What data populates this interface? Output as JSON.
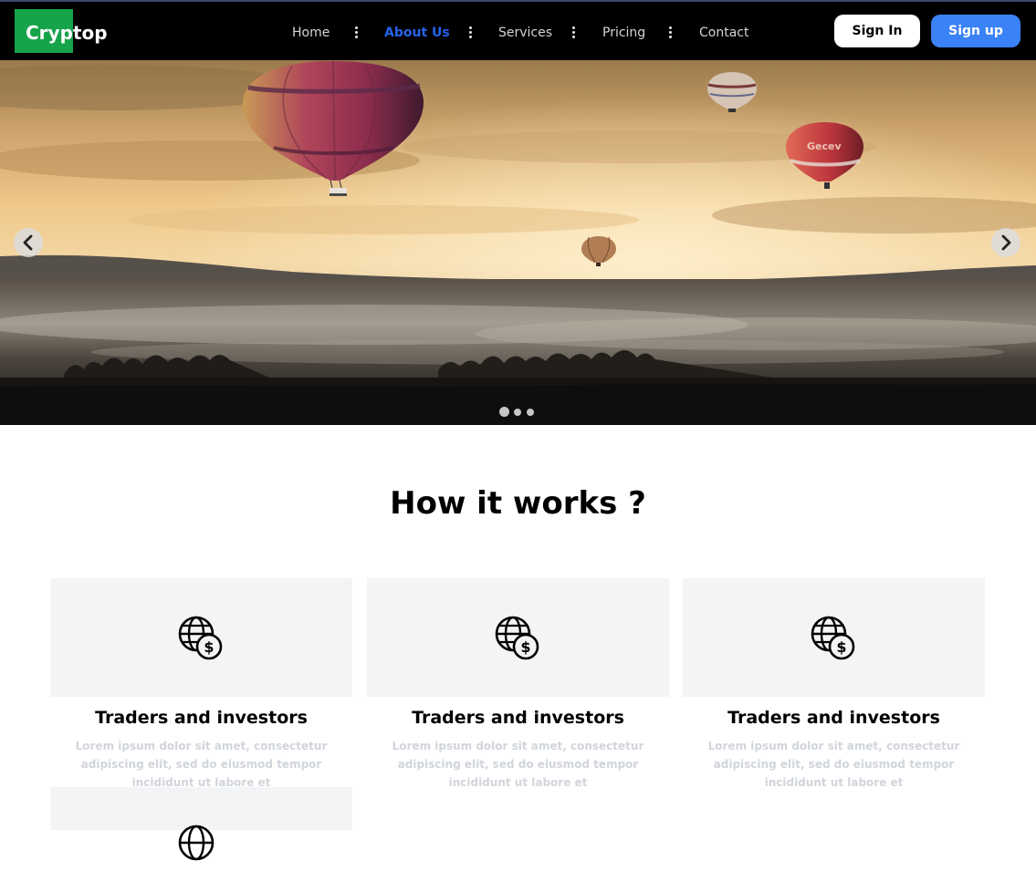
{
  "brand": {
    "name": "Cryptop",
    "logo_color": "#16a34a"
  },
  "nav": {
    "items": [
      {
        "label": "Home",
        "active": false
      },
      {
        "label": "About Us",
        "active": true
      },
      {
        "label": "Services",
        "active": false
      },
      {
        "label": "Pricing",
        "active": false
      },
      {
        "label": "Contact",
        "active": false
      }
    ],
    "separator_icon": "vertical-dots-icon",
    "active_color": "#2563eb"
  },
  "auth": {
    "signin_label": "Sign In",
    "signup_label": "Sign up",
    "signup_color": "#3b82f6"
  },
  "carousel": {
    "image_subject": "hot air balloons over misty valley at sunset",
    "prev_icon": "chevron-left-icon",
    "next_icon": "chevron-right-icon",
    "slide_count": 3,
    "active_slide": 1
  },
  "how_it_works": {
    "title": "How it works ?",
    "cards": [
      {
        "icon": "globe-dollar-icon",
        "title": "Traders and investors",
        "text": "Lorem ipsum dolor sit amet, consectetur adipiscing elit, sed do eiusmod tempor incididunt ut labore et"
      },
      {
        "icon": "globe-dollar-icon",
        "title": "Traders and investors",
        "text": "Lorem ipsum dolor sit amet, consectetur adipiscing elit, sed do eiusmod tempor incididunt ut labore et"
      },
      {
        "icon": "globe-dollar-icon",
        "title": "Traders and investors",
        "text": "Lorem ipsum dolor sit amet, consectetur adipiscing elit, sed do eiusmod tempor incididunt ut labore et"
      },
      {
        "icon": "globe-dollar-icon"
      }
    ]
  }
}
